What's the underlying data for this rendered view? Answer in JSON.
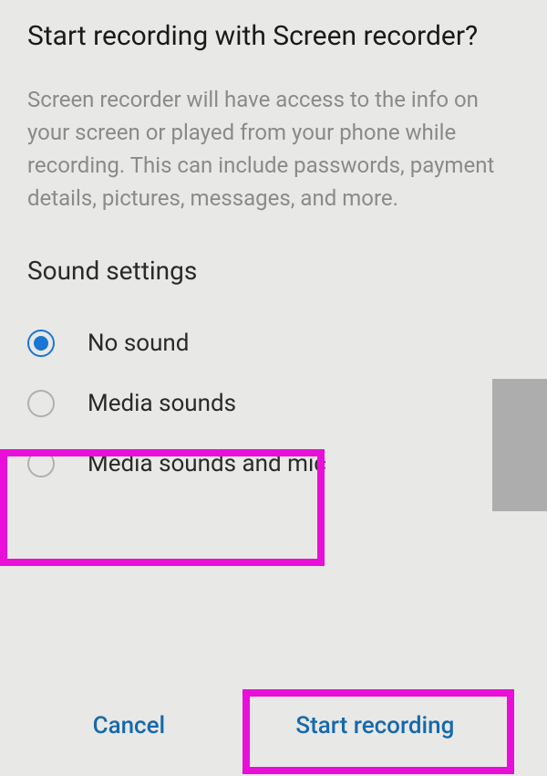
{
  "dialog": {
    "title": "Start recording with Screen recorder?",
    "description": "Screen recorder will have access to the info on your screen or played from your phone while recording. This can include passwords, payment details, pictures, messages, and more.",
    "section_title": "Sound settings",
    "options": [
      {
        "label": "No sound",
        "selected": true
      },
      {
        "label": "Media sounds",
        "selected": false
      },
      {
        "label": "Media sounds and mic",
        "selected": false
      }
    ],
    "cancel_label": "Cancel",
    "start_label": "Start recording"
  }
}
